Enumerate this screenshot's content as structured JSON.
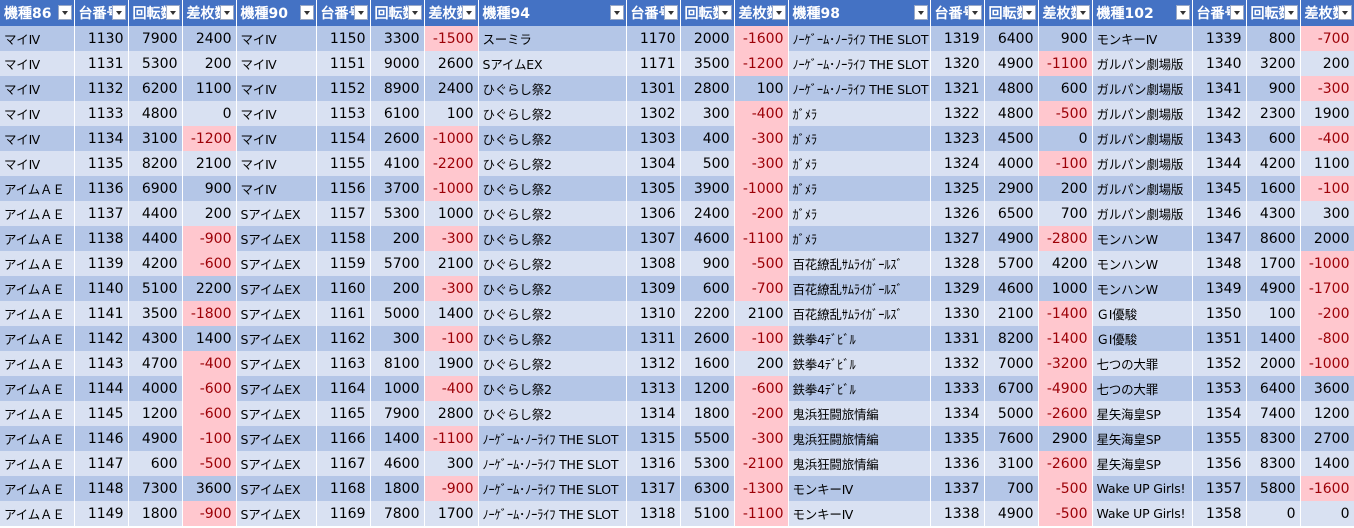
{
  "colors": {
    "header_bg": "#4472c4",
    "row_odd": "#b4c6e7",
    "row_even": "#d9e1f2",
    "neg_bg": "#ffc7ce",
    "neg_text": "#9c0006"
  },
  "header": [
    "機種86",
    "台番号",
    "回転数",
    "差枚数",
    "機種90",
    "台番号",
    "回転数",
    "差枚数",
    "機種94",
    "台番号",
    "回転数",
    "差枚数",
    "機種98",
    "台番号",
    "回転数",
    "差枚数",
    "機種102",
    "台番号",
    "回転数",
    "差枚数"
  ],
  "rows": [
    [
      "マイⅣ",
      "1130",
      "7900",
      "2400",
      "マイⅣ",
      "1150",
      "3300",
      "-1500",
      "スーミラ",
      "1170",
      "2000",
      "-1600",
      "ﾉｰｹﾞｰﾑ･ﾉｰﾗｲﾌ THE SLOT",
      "1319",
      "6400",
      "900",
      "モンキーⅣ",
      "1339",
      "800",
      "-700"
    ],
    [
      "マイⅣ",
      "1131",
      "5300",
      "200",
      "マイⅣ",
      "1151",
      "9000",
      "2600",
      "SアイムEX",
      "1171",
      "3500",
      "-1200",
      "ﾉｰｹﾞｰﾑ･ﾉｰﾗｲﾌ THE SLOT",
      "1320",
      "4900",
      "-1100",
      "ガルパン劇場版",
      "1340",
      "3200",
      "200"
    ],
    [
      "マイⅣ",
      "1132",
      "6200",
      "1100",
      "マイⅣ",
      "1152",
      "8900",
      "2400",
      "ひぐらし祭2",
      "1301",
      "2800",
      "100",
      "ﾉｰｹﾞｰﾑ･ﾉｰﾗｲﾌ THE SLOT",
      "1321",
      "4800",
      "600",
      "ガルパン劇場版",
      "1341",
      "900",
      "-300"
    ],
    [
      "マイⅣ",
      "1133",
      "4800",
      "0",
      "マイⅣ",
      "1153",
      "6100",
      "100",
      "ひぐらし祭2",
      "1302",
      "300",
      "-400",
      "ｶﾞﾒﾗ",
      "1322",
      "4800",
      "-500",
      "ガルパン劇場版",
      "1342",
      "2300",
      "1900"
    ],
    [
      "マイⅣ",
      "1134",
      "3100",
      "-1200",
      "マイⅣ",
      "1154",
      "2600",
      "-1000",
      "ひぐらし祭2",
      "1303",
      "400",
      "-300",
      "ｶﾞﾒﾗ",
      "1323",
      "4500",
      "0",
      "ガルパン劇場版",
      "1343",
      "600",
      "-400"
    ],
    [
      "マイⅣ",
      "1135",
      "8200",
      "2100",
      "マイⅣ",
      "1155",
      "4100",
      "-2200",
      "ひぐらし祭2",
      "1304",
      "500",
      "-300",
      "ｶﾞﾒﾗ",
      "1324",
      "4000",
      "-100",
      "ガルパン劇場版",
      "1344",
      "4200",
      "1100"
    ],
    [
      "アイムＡＥ",
      "1136",
      "6900",
      "900",
      "マイⅣ",
      "1156",
      "3700",
      "-1000",
      "ひぐらし祭2",
      "1305",
      "3900",
      "-1000",
      "ｶﾞﾒﾗ",
      "1325",
      "2900",
      "200",
      "ガルパン劇場版",
      "1345",
      "1600",
      "-100"
    ],
    [
      "アイムＡＥ",
      "1137",
      "4400",
      "200",
      "SアイムEX",
      "1157",
      "5300",
      "1000",
      "ひぐらし祭2",
      "1306",
      "2400",
      "-200",
      "ｶﾞﾒﾗ",
      "1326",
      "6500",
      "700",
      "ガルパン劇場版",
      "1346",
      "4300",
      "300"
    ],
    [
      "アイムＡＥ",
      "1138",
      "4400",
      "-900",
      "SアイムEX",
      "1158",
      "200",
      "-300",
      "ひぐらし祭2",
      "1307",
      "4600",
      "-1100",
      "ｶﾞﾒﾗ",
      "1327",
      "4900",
      "-2800",
      "モンハンW",
      "1347",
      "8600",
      "2000"
    ],
    [
      "アイムＡＥ",
      "1139",
      "4200",
      "-600",
      "SアイムEX",
      "1159",
      "5700",
      "2100",
      "ひぐらし祭2",
      "1308",
      "900",
      "-500",
      "百花繚乱ｻﾑﾗｲｶﾞｰﾙｽﾞ",
      "1328",
      "5700",
      "4200",
      "モンハンW",
      "1348",
      "1700",
      "-1000"
    ],
    [
      "アイムＡＥ",
      "1140",
      "5100",
      "2200",
      "SアイムEX",
      "1160",
      "200",
      "-300",
      "ひぐらし祭2",
      "1309",
      "600",
      "-700",
      "百花繚乱ｻﾑﾗｲｶﾞｰﾙｽﾞ",
      "1329",
      "4600",
      "1000",
      "モンハンW",
      "1349",
      "4900",
      "-1700"
    ],
    [
      "アイムＡＥ",
      "1141",
      "3500",
      "-1800",
      "SアイムEX",
      "1161",
      "5000",
      "1400",
      "ひぐらし祭2",
      "1310",
      "2200",
      "2100",
      "百花繚乱ｻﾑﾗｲｶﾞｰﾙｽﾞ",
      "1330",
      "2100",
      "-1400",
      "ＧⅠ優駿",
      "1350",
      "100",
      "-200"
    ],
    [
      "アイムＡＥ",
      "1142",
      "4300",
      "1400",
      "SアイムEX",
      "1162",
      "300",
      "-100",
      "ひぐらし祭2",
      "1311",
      "2600",
      "-100",
      "鉄拳4ﾃﾞﾋﾞﾙ",
      "1331",
      "8200",
      "-1400",
      "ＧⅠ優駿",
      "1351",
      "1400",
      "-800"
    ],
    [
      "アイムＡＥ",
      "1143",
      "4700",
      "-400",
      "SアイムEX",
      "1163",
      "8100",
      "1900",
      "ひぐらし祭2",
      "1312",
      "1600",
      "200",
      "鉄拳4ﾃﾞﾋﾞﾙ",
      "1332",
      "7000",
      "-3200",
      "七つの大罪",
      "1352",
      "2000",
      "-1000"
    ],
    [
      "アイムＡＥ",
      "1144",
      "4000",
      "-600",
      "SアイムEX",
      "1164",
      "1000",
      "-400",
      "ひぐらし祭2",
      "1313",
      "1200",
      "-600",
      "鉄拳4ﾃﾞﾋﾞﾙ",
      "1333",
      "6700",
      "-4900",
      "七つの大罪",
      "1353",
      "6400",
      "3600"
    ],
    [
      "アイムＡＥ",
      "1145",
      "1200",
      "-600",
      "SアイムEX",
      "1165",
      "7900",
      "2800",
      "ひぐらし祭2",
      "1314",
      "1800",
      "-200",
      "鬼浜狂闘旅情編",
      "1334",
      "5000",
      "-2600",
      "星矢海皇SP",
      "1354",
      "7400",
      "1200"
    ],
    [
      "アイムＡＥ",
      "1146",
      "4900",
      "-100",
      "SアイムEX",
      "1166",
      "1400",
      "-1100",
      "ﾉｰｹﾞｰﾑ･ﾉｰﾗｲﾌ THE SLOT",
      "1315",
      "5500",
      "-300",
      "鬼浜狂闘旅情編",
      "1335",
      "7600",
      "2900",
      "星矢海皇SP",
      "1355",
      "8300",
      "2700"
    ],
    [
      "アイムＡＥ",
      "1147",
      "600",
      "-500",
      "SアイムEX",
      "1167",
      "4600",
      "300",
      "ﾉｰｹﾞｰﾑ･ﾉｰﾗｲﾌ THE SLOT",
      "1316",
      "5300",
      "-2100",
      "鬼浜狂闘旅情編",
      "1336",
      "3100",
      "-2600",
      "星矢海皇SP",
      "1356",
      "8300",
      "1400"
    ],
    [
      "アイムＡＥ",
      "1148",
      "7300",
      "3600",
      "SアイムEX",
      "1168",
      "1800",
      "-900",
      "ﾉｰｹﾞｰﾑ･ﾉｰﾗｲﾌ THE SLOT",
      "1317",
      "6300",
      "-1300",
      "モンキーⅣ",
      "1337",
      "700",
      "-500",
      "Wake UP Girls!",
      "1357",
      "5800",
      "-1600"
    ],
    [
      "アイムＡＥ",
      "1149",
      "1800",
      "-900",
      "SアイムEX",
      "1169",
      "7800",
      "1700",
      "ﾉｰｹﾞｰﾑ･ﾉｰﾗｲﾌ THE SLOT",
      "1318",
      "5100",
      "-1100",
      "モンキーⅣ",
      "1338",
      "4900",
      "-500",
      "Wake UP Girls!",
      "1358",
      "0",
      "0"
    ]
  ]
}
